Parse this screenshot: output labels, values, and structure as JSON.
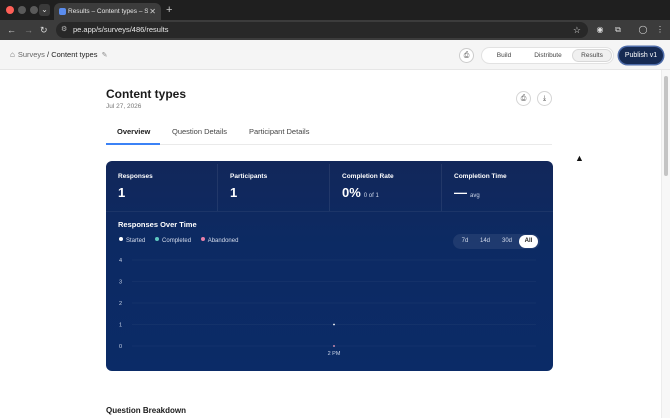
{
  "browser": {
    "tab_title": "Results – Content types – Su",
    "url": "pe.app/s/surveys/486/results"
  },
  "header": {
    "breadcrumb_root": "Surveys",
    "breadcrumb_current": "/ Content types",
    "modes": [
      "Build",
      "Distribute",
      "Results"
    ],
    "active_mode": "Results",
    "publish_label": "Publish v1"
  },
  "page": {
    "title": "Content types",
    "date": "Jul 27, 2026",
    "tabs": [
      "Overview",
      "Question Details",
      "Participant Details"
    ],
    "active_tab": "Overview",
    "next_section_title": "Question Breakdown"
  },
  "metrics": [
    {
      "label": "Responses",
      "value": "1",
      "sub": ""
    },
    {
      "label": "Participants",
      "value": "1",
      "sub": ""
    },
    {
      "label": "Completion Rate",
      "value": "0%",
      "sub": "0 of 1"
    },
    {
      "label": "Completion Time",
      "value": "—",
      "sub": "avg"
    }
  ],
  "responses_over_time": {
    "title": "Responses Over Time",
    "legend": [
      {
        "name": "Started",
        "color": "#ffffff"
      },
      {
        "name": "Completed",
        "color": "#5ec8c0"
      },
      {
        "name": "Abandoned",
        "color": "#e87fa8"
      }
    ],
    "ranges": [
      "7d",
      "14d",
      "30d",
      "All"
    ],
    "active_range": "All"
  },
  "chart_data": {
    "type": "line",
    "title": "Responses Over Time",
    "x": [
      "2 PM"
    ],
    "series": [
      {
        "name": "Started",
        "values": [
          1
        ]
      },
      {
        "name": "Completed",
        "values": [
          0
        ]
      },
      {
        "name": "Abandoned",
        "values": [
          0
        ]
      }
    ],
    "ylim": [
      0,
      4
    ],
    "yticks": [
      0,
      1,
      2,
      3,
      4
    ],
    "grid": true,
    "legend_position": "top-left"
  }
}
